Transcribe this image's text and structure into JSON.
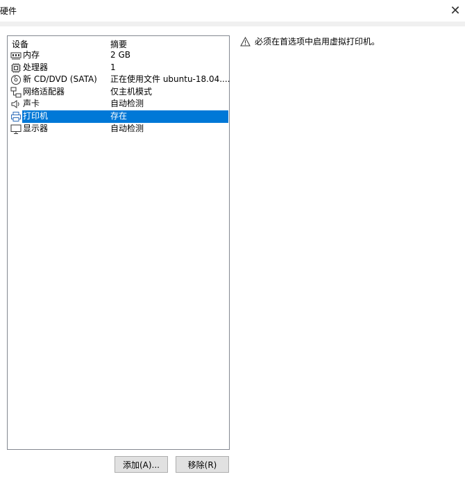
{
  "window": {
    "title": "硬件",
    "close_glyph": "✕"
  },
  "devices": {
    "headers": {
      "device": "设备",
      "summary": "摘要"
    },
    "selected_index": 5,
    "items": [
      {
        "name": "内存",
        "summary": "2 GB",
        "icon": "memory-icon"
      },
      {
        "name": "处理器",
        "summary": "1",
        "icon": "processor-icon"
      },
      {
        "name": "新 CD/DVD (SATA)",
        "summary": "正在使用文件 ubuntu-18.04....",
        "icon": "cd-dvd-icon"
      },
      {
        "name": "网络适配器",
        "summary": "仅主机模式",
        "icon": "network-adapter-icon"
      },
      {
        "name": "声卡",
        "summary": "自动检测",
        "icon": "sound-card-icon"
      },
      {
        "name": "打印机",
        "summary": "存在",
        "icon": "printer-icon"
      },
      {
        "name": "显示器",
        "summary": "自动检测",
        "icon": "display-icon"
      }
    ]
  },
  "warning": {
    "icon": "warning-icon",
    "text": "必须在首选项中启用虚拟打印机。"
  },
  "buttons": {
    "add": "添加(A)...",
    "remove": "移除(R)"
  },
  "colors": {
    "selection": "#0078d7",
    "border": "#828790"
  }
}
